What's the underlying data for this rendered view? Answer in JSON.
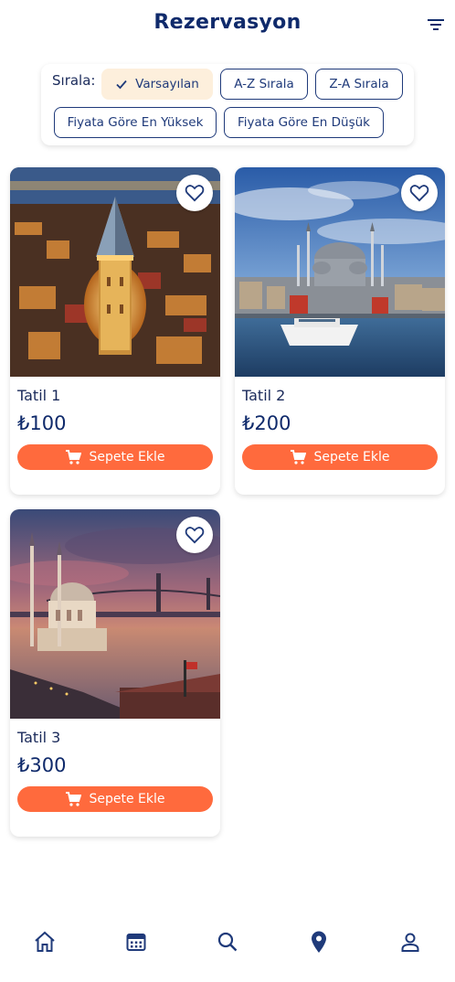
{
  "header": {
    "title": "Rezervasyon",
    "filter_icon": "filter-list-icon"
  },
  "sort": {
    "label": "Sırala:",
    "options": [
      {
        "label": "Varsayılan",
        "selected": true
      },
      {
        "label": "A-Z Sırala",
        "selected": false
      },
      {
        "label": "Z-A Sırala",
        "selected": false
      },
      {
        "label": "Fiyata Göre En Yüksek",
        "selected": false
      },
      {
        "label": "Fiyata Göre En Düşük",
        "selected": false
      }
    ]
  },
  "cart_label": "Sepete Ekle",
  "products": [
    {
      "name": "Tatil 1",
      "price": "₺100",
      "image": "galata-tower-night"
    },
    {
      "name": "Tatil 2",
      "price": "₺200",
      "image": "suleymaniye-mosque-bosphorus"
    },
    {
      "name": "Tatil 3",
      "price": "₺300",
      "image": "ortakoy-mosque-sunset"
    }
  ],
  "nav": {
    "items": [
      {
        "icon": "home-icon"
      },
      {
        "icon": "calendar-icon"
      },
      {
        "icon": "search-icon"
      },
      {
        "icon": "location-pin-icon"
      },
      {
        "icon": "profile-icon"
      }
    ]
  },
  "colors": {
    "primary": "#0f2a6b",
    "accent": "#ff6a3d",
    "chip_selected_bg": "#fdefdc"
  }
}
